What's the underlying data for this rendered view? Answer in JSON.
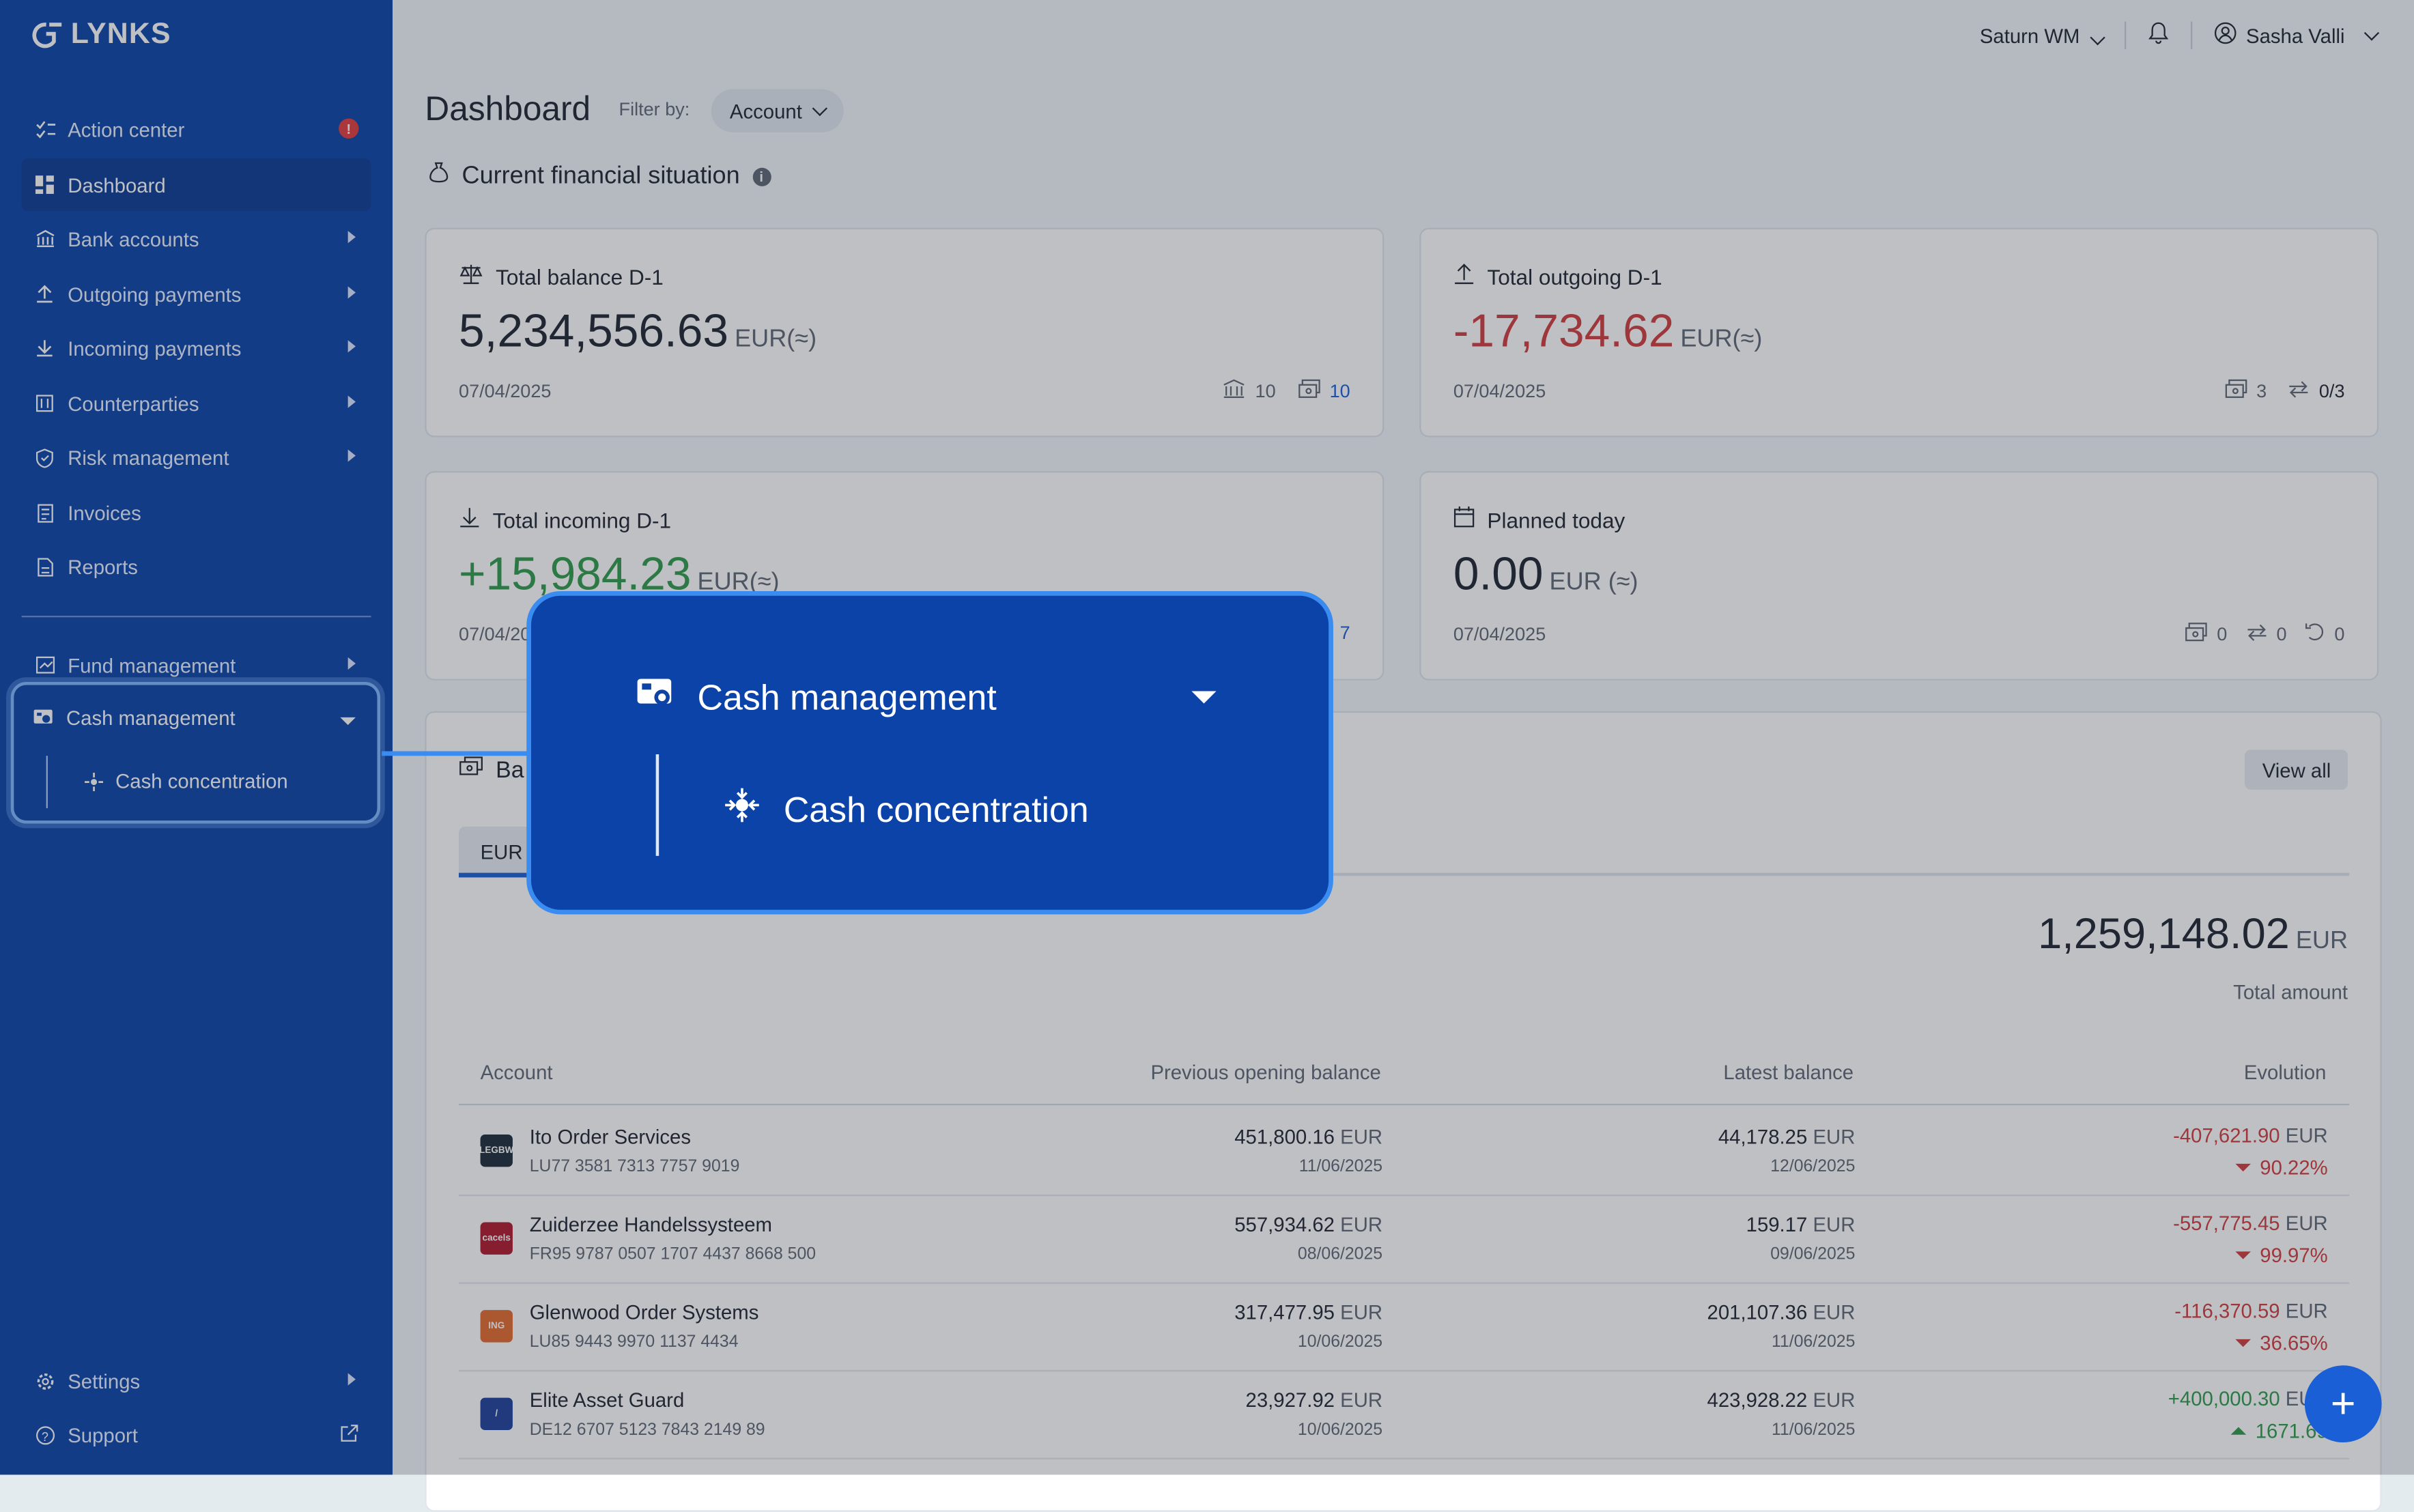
{
  "brand": {
    "name": "LYNKS"
  },
  "sidebar": {
    "items": [
      {
        "label": "Action center",
        "icon": "tasks-icon"
      },
      {
        "label": "Dashboard",
        "icon": "dashboard-icon"
      },
      {
        "label": "Bank accounts",
        "icon": "bank-icon"
      },
      {
        "label": "Outgoing payments",
        "icon": "upload-icon"
      },
      {
        "label": "Incoming payments",
        "icon": "download-icon"
      },
      {
        "label": "Counterparties",
        "icon": "building-icon"
      },
      {
        "label": "Risk management",
        "icon": "shield-icon"
      },
      {
        "label": "Invoices",
        "icon": "invoice-icon"
      },
      {
        "label": "Reports",
        "icon": "report-icon"
      }
    ],
    "fund_management": "Fund management",
    "cash_management": "Cash management",
    "cash_concentration": "Cash concentration",
    "settings": "Settings",
    "support": "Support",
    "action_badge": "!"
  },
  "topbar": {
    "org": "Saturn WM",
    "user": "Sasha Valli"
  },
  "page": {
    "title": "Dashboard",
    "filter_label": "Filter by:",
    "filter_value": "Account",
    "section": "Current financial situation"
  },
  "cards": {
    "balance": {
      "title": "Total balance D-1",
      "value": "5,234,556.63",
      "currency": "EUR(≈)",
      "date": "07/04/2025",
      "banks": "10",
      "accounts": "10"
    },
    "outgoing": {
      "title": "Total outgoing D-1",
      "value": "-17,734.62",
      "currency": "EUR(≈)",
      "date": "07/04/2025",
      "accounts": "3",
      "transfers": "0/3"
    },
    "incoming": {
      "title": "Total incoming D-1",
      "value": "+15,984.23",
      "currency": "EUR(≈)",
      "date": "07/04/2025",
      "accounts": "7"
    },
    "planned": {
      "title": "Planned today",
      "value": "0.00",
      "currency": "EUR (≈)",
      "date": "07/04/2025",
      "accounts": "0",
      "transfers": "0",
      "recurring": "0"
    }
  },
  "balances": {
    "title": "Ba",
    "view_all": "View all",
    "tab": "EUR",
    "total": "1,259,148.02",
    "total_currency": "EUR",
    "total_label": "Total amount",
    "columns": [
      "Account",
      "Previous opening balance",
      "Latest balance",
      "Evolution"
    ],
    "rows": [
      {
        "name": "Ito Order Services",
        "iban": "LU77 3581 7313 7757 9019",
        "prev": "451,800.16",
        "prev_date": "11/06/2025",
        "latest": "44,178.25",
        "latest_date": "12/06/2025",
        "evo": "-407,621.90",
        "pct": "90.22%",
        "logo_text": "LEGBW",
        "logo_color": "#1e2a3a"
      },
      {
        "name": "Zuiderzee Handelssysteem",
        "iban": "FR95 9787 0507 1707 4437 8668 500",
        "prev": "557,934.62",
        "prev_date": "08/06/2025",
        "latest": "159.17",
        "latest_date": "09/06/2025",
        "evo": "-557,775.45",
        "pct": "99.97%",
        "logo_text": "cacels",
        "logo_color": "#b0172b"
      },
      {
        "name": "Glenwood Order Systems",
        "iban": "LU85 9443 9970 1137 4434",
        "prev": "317,477.95",
        "prev_date": "10/06/2025",
        "latest": "201,107.36",
        "latest_date": "11/06/2025",
        "evo": "-116,370.59",
        "pct": "36.65%",
        "logo_text": "ING",
        "logo_color": "#e4692a"
      },
      {
        "name": "Elite Asset Guard",
        "iban": "DE12 6707 5123 7843 2149 89",
        "prev": "23,927.92",
        "prev_date": "10/06/2025",
        "latest": "423,928.22",
        "latest_date": "11/06/2025",
        "evo": "+400,000.30",
        "pct": "1671.69",
        "logo_text": "/",
        "logo_color": "#1d3f9a"
      }
    ],
    "currency": "EUR"
  },
  "zoom": {
    "title": "Cash management",
    "sub": "Cash concentration"
  },
  "colors": {
    "accent": "#0b43a8",
    "highlight": "#3b8cf0",
    "negative": "#d23b3b",
    "positive": "#2f9a4a"
  }
}
